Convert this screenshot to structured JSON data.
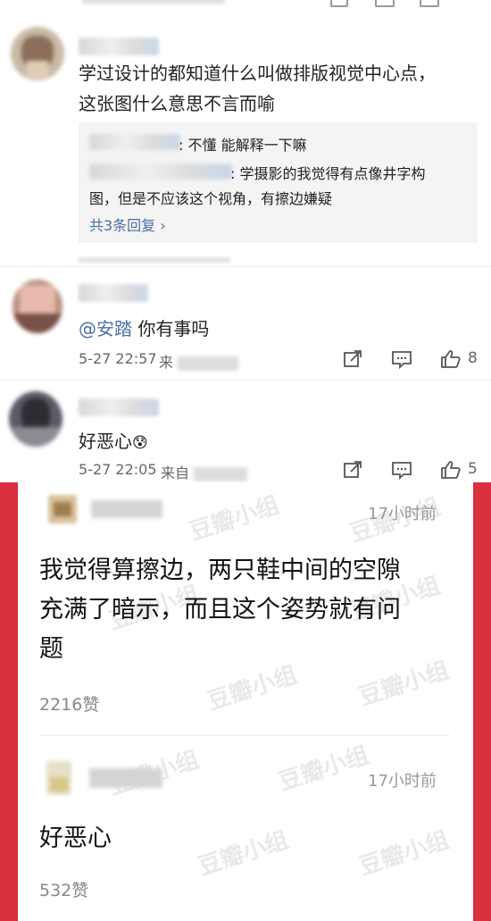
{
  "comments": [
    {
      "text_line1": "学过设计的都知道什么叫做排版视觉中心点，",
      "text_line2": "这张图什么意思不言而喻",
      "replies": [
        {
          "suffix": ": 不懂 能解释一下嘛"
        },
        {
          "suffix": ": 学摄影的我觉得有点像井字构",
          "cont": "图，但是不应该这个视角，有擦边嫌疑"
        }
      ],
      "reply_link": "共3条回复 ›"
    },
    {
      "mention": "@安踏",
      "text": " 你有事吗",
      "time": "5-27 22:57",
      "source_prefix": "来",
      "like_count": "8"
    },
    {
      "text": "好恶心",
      "emoji": "😰",
      "time": "5-27 22:05",
      "source_prefix": "来自",
      "like_count": "5"
    }
  ],
  "douban": {
    "watermark": "豆瓣小组",
    "posts": [
      {
        "time": "17小时前",
        "text_line1": "我觉得算擦边，两只鞋中间的空隙",
        "text_line2": "充满了暗示，而且这个姿势就有问",
        "text_line3": "题",
        "likes": "2216赞"
      },
      {
        "time": "17小时前",
        "text": "好恶心",
        "likes": "532赞"
      }
    ]
  },
  "icons": {
    "share": "share-icon",
    "comment": "comment-icon",
    "like": "thumbs-up-icon"
  }
}
